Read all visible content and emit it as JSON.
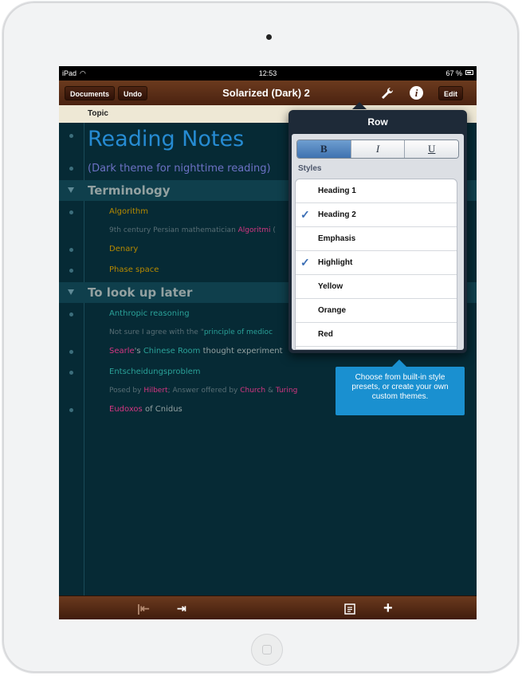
{
  "statusbar": {
    "device": "iPad",
    "time": "12:53",
    "battery": "67 %"
  },
  "navbar": {
    "documents": "Documents",
    "undo": "Undo",
    "title": "Solarized (Dark) 2",
    "edit": "Edit"
  },
  "topic_header": "Topic",
  "rows": {
    "r0": "Reading Notes",
    "r1": "(Dark theme for nighttime reading)",
    "r2": "Terminology",
    "r3": "Algorithm",
    "r4a": "9th century Persian mathematician ",
    "r4b": "Algoritmi",
    "r4c": " (",
    "r5": "Denary",
    "r6": "Phase space",
    "r7": "To look up later",
    "r8": "Anthropic reasoning",
    "r9a": "Not sure I agree with the \"",
    "r9b": "principle of medioc",
    "r10a": "Searle",
    "r10b": "'s ",
    "r10c": "Chinese Room",
    "r10d": " thought experiment",
    "r11": "Entscheidungsproblem",
    "r12a": "Posed by ",
    "r12b": "Hilbert",
    "r12c": "; Answer offered by ",
    "r12d": "Church",
    "r12e": " & ",
    "r12f": "Turing",
    "r13a": "Eudoxos",
    "r13b": " of Cnidus"
  },
  "popover": {
    "title": "Row",
    "segments": {
      "bold": "B",
      "italic": "I",
      "underline": "U"
    },
    "styles_label": "Styles",
    "items": [
      {
        "label": "Heading 1",
        "checked": false
      },
      {
        "label": "Heading 2",
        "checked": true
      },
      {
        "label": "Emphasis",
        "checked": false
      },
      {
        "label": "Highlight",
        "checked": true
      },
      {
        "label": "Yellow",
        "checked": false
      },
      {
        "label": "Orange",
        "checked": false
      },
      {
        "label": "Red",
        "checked": false
      }
    ],
    "check_glyph": "✓"
  },
  "tooltip": "Choose from built-in style presets, or create your own custom themes.",
  "colors": {
    "base03": "#062a35",
    "blue": "#268bd2",
    "violet": "#6c71c4",
    "yellow": "#b58900",
    "orange": "#cb4b16",
    "magenta": "#d33682",
    "cyan": "#2aa198",
    "base0": "#839496",
    "base1": "#93a1a1",
    "base2": "#eee8d5"
  },
  "icons": {
    "wrench": "wrench-icon",
    "info": "info-icon",
    "outdent": "outdent-icon",
    "indent": "indent-icon",
    "note": "note-icon",
    "add": "plus-icon"
  }
}
